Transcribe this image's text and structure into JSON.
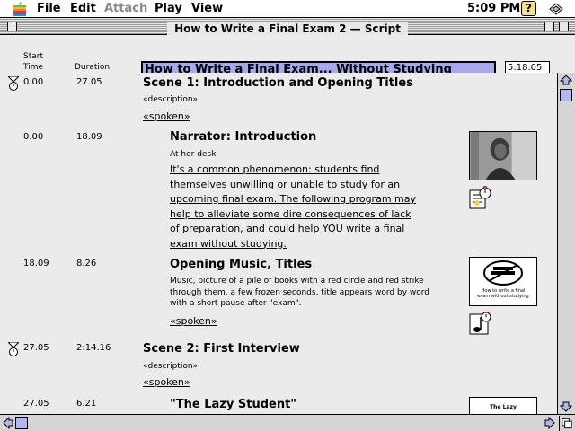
{
  "menubar": {
    "apple_icon": "apple-icon",
    "items": [
      {
        "label": "File",
        "enabled": true
      },
      {
        "label": "Edit",
        "enabled": true
      },
      {
        "label": "Attach",
        "enabled": false
      },
      {
        "label": "Play",
        "enabled": true
      },
      {
        "label": "View",
        "enabled": true
      }
    ],
    "clock": "5:09 PM",
    "help_glyph": "?"
  },
  "window": {
    "title": "How to Write a Final Exam 2 — Script"
  },
  "header": {
    "start_time_label": "Start Time",
    "duration_label": "Duration",
    "document_title": "How to Write a Final Exam... Without Studying",
    "total_time": "5:18.05"
  },
  "scenes": [
    {
      "start": "0.00",
      "duration": "27.05",
      "title": "Scene 1: Introduction and Opening Titles",
      "description_tag": "«description»",
      "spoken_tag": "«spoken»"
    },
    {
      "start": "27.05",
      "duration": "2:14.16",
      "title": "Scene 2: First Interview",
      "description_tag": "«description»",
      "spoken_tag": "«spoken»"
    }
  ],
  "segments": [
    {
      "start": "0.00",
      "duration": "18.09",
      "title": "Narrator: Introduction",
      "description": "At her desk",
      "spoken_lines": [
        "It's a common phenomenon: students find",
        "themselves unwilling or unable to study for an",
        "upcoming final exam.  The following program may",
        "help to alleviate some dire consequences of lack",
        "of preparation, and could help YOU write a final",
        "exam without studying."
      ]
    },
    {
      "start": "18.09",
      "duration": "8.26",
      "title": "Opening Music, Titles",
      "description_lines": [
        "Music, picture of a pile of books with a red circle and red strike",
        "through them, a few frozen seconds, title appears word by word",
        "with a short pause after \"exam\"."
      ],
      "spoken_tag": "«spoken»",
      "thumb_caption": "How to write a final exam without studying"
    },
    {
      "start": "27.05",
      "duration": "6.21",
      "title": "\"The Lazy Student\"",
      "thumb_caption": "The Lazy"
    }
  ],
  "colors": {
    "title_field": "#a9a7ee",
    "scroll_thumb": "#b5b5f0",
    "content_bg": "#ebebeb"
  }
}
